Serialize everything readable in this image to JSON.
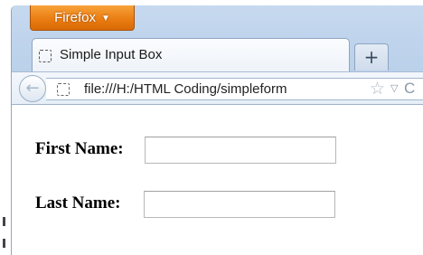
{
  "browser": {
    "menu_button_label": "Firefox",
    "menu_button_caret": "▼",
    "tab": {
      "title": "Simple Input Box",
      "favicon": "blank-page-icon"
    },
    "new_tab_label": "+",
    "back_icon": "←",
    "url": "file:///H:/HTML Coding/simpleform",
    "url_overflow_char": "C",
    "bookmark_star": "☆",
    "history_dropmark": "▽"
  },
  "form": {
    "first_name_label": "First Name:",
    "first_name_value": "",
    "last_name_label": "Last Name:",
    "last_name_value": ""
  },
  "colors": {
    "menu_button": "#e97b10",
    "chrome_background": "#bed3ec"
  }
}
